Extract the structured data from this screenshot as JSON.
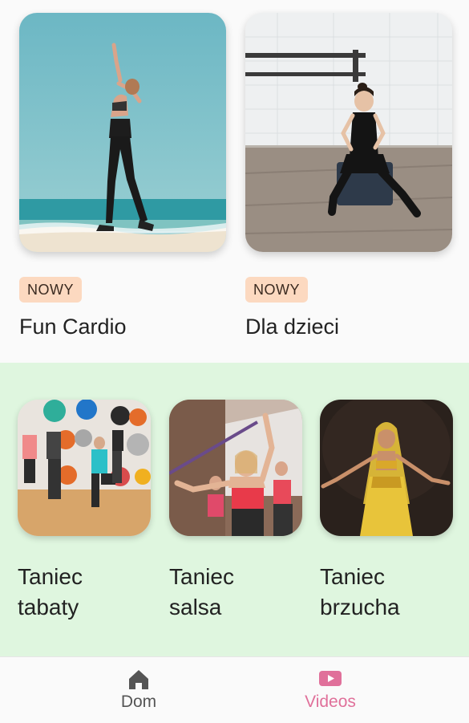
{
  "featured": [
    {
      "badge": "NOWY",
      "title": "Fun Cardio"
    },
    {
      "badge": "NOWY",
      "title": "Dla dzieci"
    }
  ],
  "categories": [
    {
      "line1": "Taniec",
      "line2": "tabaty"
    },
    {
      "line1": "Taniec",
      "line2": "salsa"
    },
    {
      "line1": "Taniec",
      "line2": "brzucha"
    }
  ],
  "nav": {
    "home_label": "Dom",
    "videos_label": "Videos",
    "active": "videos",
    "active_color": "#e0709a",
    "inactive_color": "#555555"
  }
}
